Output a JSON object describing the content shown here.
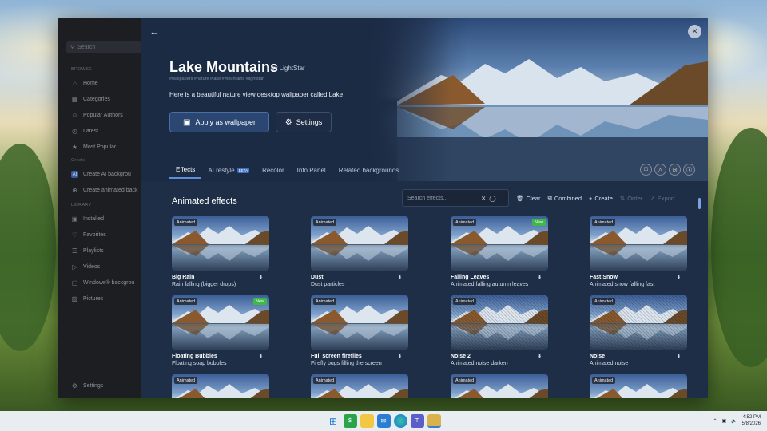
{
  "sidebar": {
    "search_placeholder": "Search",
    "sections": {
      "browse": "BROWSE",
      "create": "Create",
      "library": "LIBRARY"
    },
    "browse_items": [
      {
        "label": "Home",
        "icon": "home-icon"
      },
      {
        "label": "Categories",
        "icon": "categories-icon"
      },
      {
        "label": "Popular Authors",
        "icon": "authors-icon"
      },
      {
        "label": "Latest",
        "icon": "clock-icon"
      },
      {
        "label": "Most Popular",
        "icon": "star-icon"
      }
    ],
    "create_items": [
      {
        "label": "Create AI backgrou",
        "icon": "ai-icon"
      },
      {
        "label": "Create animated back",
        "icon": "add-icon"
      }
    ],
    "library_items": [
      {
        "label": "Installed",
        "icon": "installed-icon"
      },
      {
        "label": "Favorites",
        "icon": "heart-icon"
      },
      {
        "label": "Playlists",
        "icon": "playlist-icon"
      },
      {
        "label": "Videos",
        "icon": "video-icon"
      },
      {
        "label": "Windows® backgrou",
        "icon": "windows-icon"
      },
      {
        "label": "Pictures",
        "icon": "picture-icon"
      }
    ],
    "settings": "Settings"
  },
  "header": {
    "title": "Lake Mountains",
    "author": "by LightStar",
    "tags": "#wallpapers  #nature  #lake  #mountains  #lightstar",
    "description": "Here is a beautiful nature view desktop wallpaper called Lake",
    "apply_label": "Apply as wallpaper",
    "settings_label": "Settings"
  },
  "tabs": [
    {
      "label": "Effects",
      "active": true
    },
    {
      "label": "AI restyle",
      "badge": "BETA"
    },
    {
      "label": "Recolor"
    },
    {
      "label": "Info Panel"
    },
    {
      "label": "Related backgrounds"
    }
  ],
  "section_title": "Animated effects",
  "toolbar": {
    "search_placeholder": "Search effects...",
    "clear": "Clear",
    "combined": "Combined",
    "create": "Create",
    "order": "Order",
    "export": "Export"
  },
  "badge_animated": "Animated",
  "badge_new": "New",
  "effects": [
    {
      "name": "Big Rain",
      "desc": "Rain falling (bigger drops)",
      "new": false
    },
    {
      "name": "Dust",
      "desc": "Dust particles",
      "new": false
    },
    {
      "name": "Falling Leaves",
      "desc": "Animated falling autumn leaves",
      "new": true
    },
    {
      "name": "Fast Snow",
      "desc": "Animated snow falling fast",
      "new": false
    },
    {
      "name": "Floating Bubbles",
      "desc": "Floating soap bubbles",
      "new": true
    },
    {
      "name": "Full screen fireflies",
      "desc": "Firefly bugs filling the screen",
      "new": false
    },
    {
      "name": "Noise 2",
      "desc": "Animated noise darken",
      "new": false
    },
    {
      "name": "Noise",
      "desc": "Animated noise",
      "new": false
    },
    {
      "name": "",
      "desc": "",
      "new": false
    },
    {
      "name": "",
      "desc": "",
      "new": false
    },
    {
      "name": "",
      "desc": "",
      "new": false
    },
    {
      "name": "",
      "desc": "",
      "new": false
    }
  ],
  "taskbar": {
    "time": "4:52 PM",
    "date": "5/8/2026"
  },
  "colors": {
    "accent": "#5b8fd9",
    "new_badge": "#3fb84a",
    "main_bg": "#1e2e47"
  }
}
